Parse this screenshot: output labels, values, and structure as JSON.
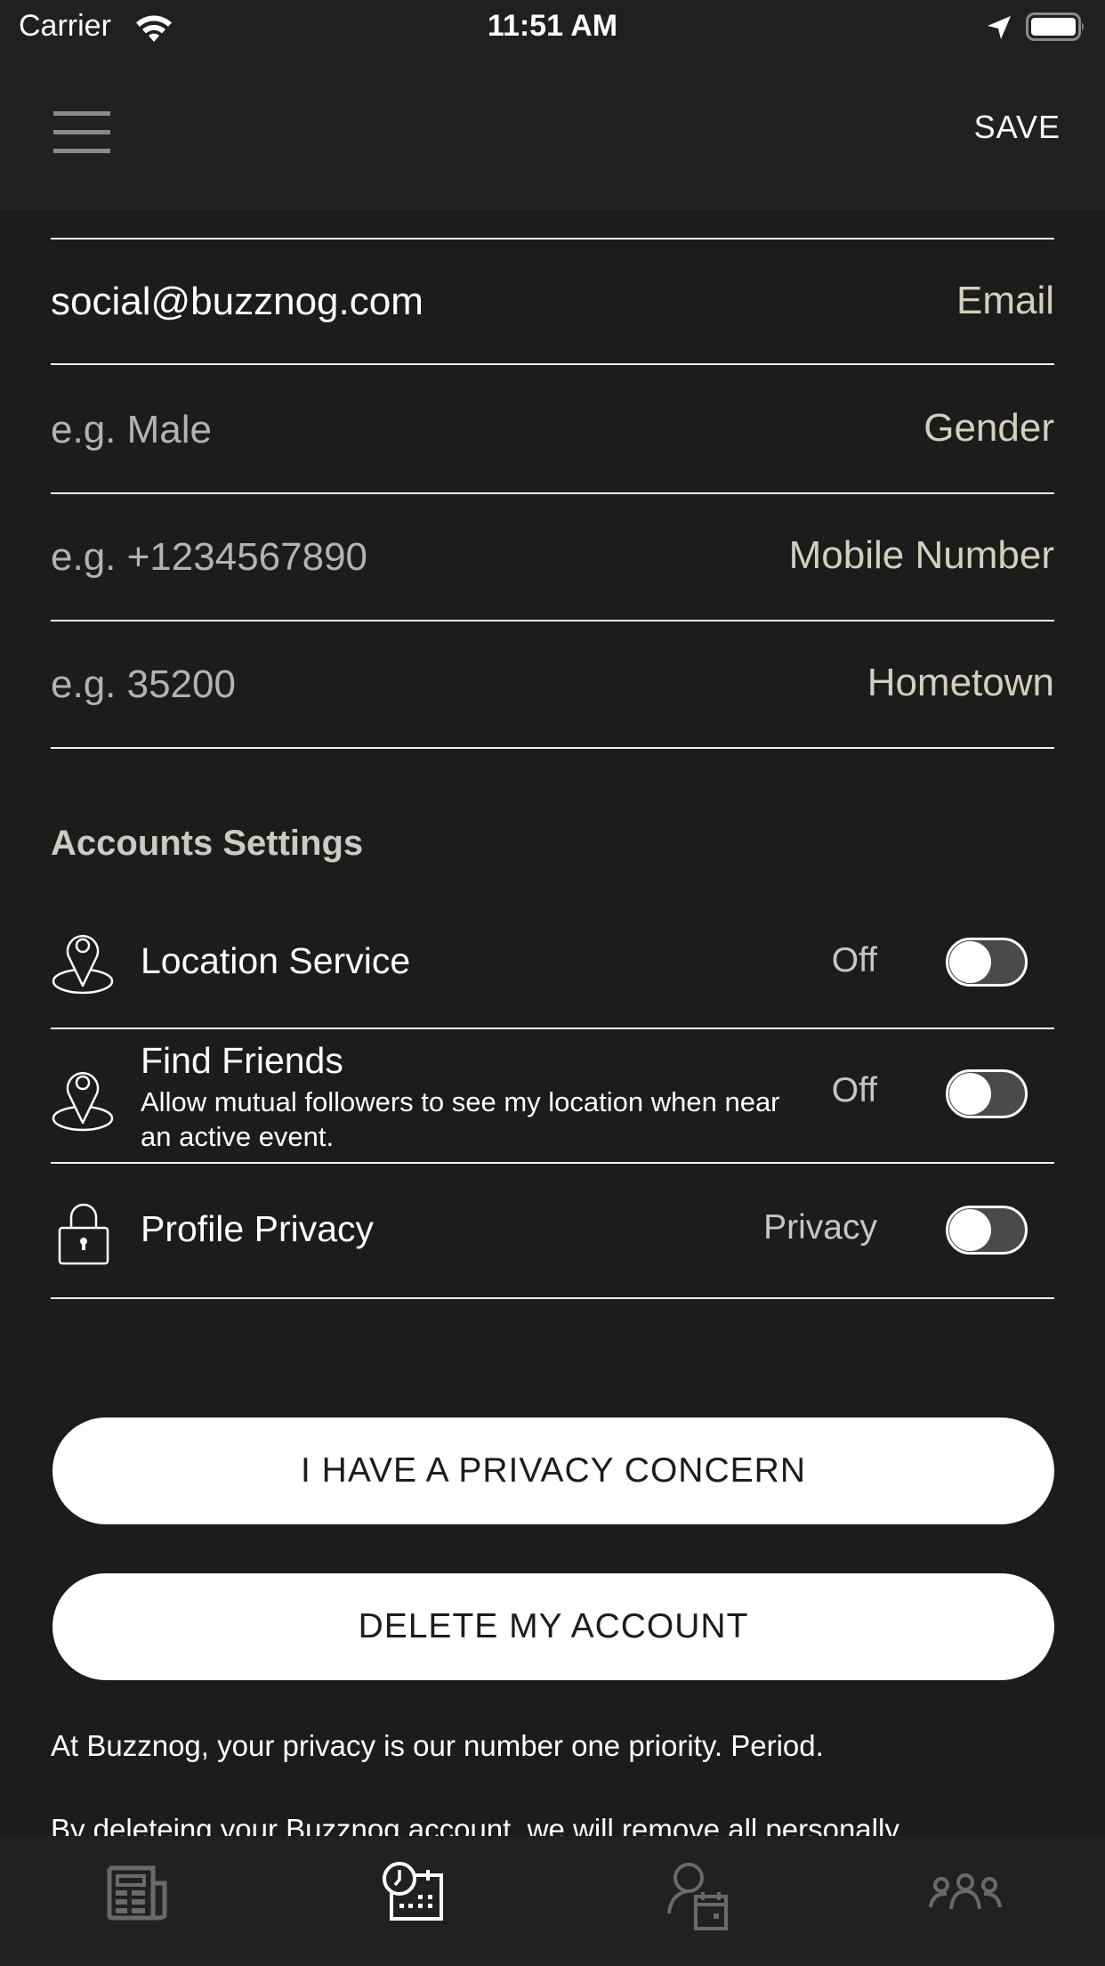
{
  "status_bar": {
    "carrier": "Carrier",
    "time": "11:51 AM",
    "icons": [
      "wifi-icon",
      "location-arrow-icon",
      "battery-icon"
    ]
  },
  "header": {
    "menu_icon": "hamburger-menu-icon",
    "save_label": "SAVE"
  },
  "profile_fields": [
    {
      "label": "Email",
      "value": "social@buzznog.com",
      "placeholder": ""
    },
    {
      "label": "Gender",
      "value": "",
      "placeholder": "e.g. Male"
    },
    {
      "label": "Mobile Number",
      "value": "",
      "placeholder": "e.g. +1234567890"
    },
    {
      "label": "Hometown",
      "value": "",
      "placeholder": "e.g. 35200"
    }
  ],
  "accounts_settings": {
    "title": "Accounts Settings",
    "items": [
      {
        "icon": "location-pin-icon",
        "title": "Location Service",
        "description": "",
        "state_label": "Off",
        "enabled": false
      },
      {
        "icon": "location-pin-icon",
        "title": "Find Friends",
        "description": "Allow mutual followers to see my location when near an active event.",
        "state_label": "Off",
        "enabled": false
      },
      {
        "icon": "lock-icon",
        "title": "Profile Privacy",
        "description": "",
        "state_label": "Privacy",
        "enabled": false
      }
    ]
  },
  "actions": {
    "privacy_concern_label": "I HAVE A PRIVACY CONCERN",
    "delete_account_label": "DELETE MY ACCOUNT"
  },
  "info_text": {
    "paragraph_1": "At Buzznog, your privacy is our number one priority. Period.",
    "paragraph_2": "By deleteing your Buzznog account, we will remove all personally"
  },
  "tab_bar": {
    "tabs": [
      {
        "icon": "newspaper-icon",
        "active": false
      },
      {
        "icon": "calendar-clock-icon",
        "active": true
      },
      {
        "icon": "user-calendar-icon",
        "active": false
      },
      {
        "icon": "group-icon",
        "active": false
      }
    ]
  },
  "colors": {
    "background": "#1c1c1c",
    "header": "#212121",
    "field_label": "#d3cfbe",
    "placeholder": "#b3b3b3",
    "toggle_track": "#4a4a4c",
    "tab_inactive": "#6a6a6a",
    "tab_active": "#ffffff"
  }
}
